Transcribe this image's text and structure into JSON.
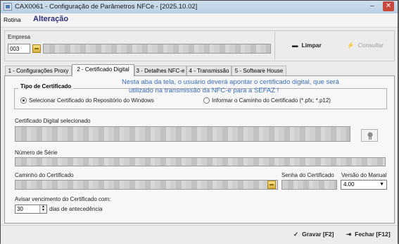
{
  "window": {
    "title": "CAX0061 - Configuração de Parâmetros NFCe - [2025.10.02]",
    "minimize": "–",
    "maximize": "□",
    "close": "✕"
  },
  "menu": {
    "rotina": "Rotina",
    "mode": "Alteração"
  },
  "empresa": {
    "label": "Empresa",
    "code": "003"
  },
  "actions": {
    "limpar": "Limpar",
    "consultar": "Consultar",
    "gravar": "Gravar [F2]",
    "fechar": "Fechar [F12]"
  },
  "tabs": [
    {
      "label": "1 - Configurações Proxy"
    },
    {
      "label": "2 - Certificado Digital"
    },
    {
      "label": "3 - Detalhes NFC-e"
    },
    {
      "label": "4 - Transmissão"
    },
    {
      "label": "5 - Software House"
    }
  ],
  "annotation": {
    "line1": "Nesta aba da tela, o usuário deverá apontar o certificado digital, que será",
    "line2": "utilizado na transmissão da NFC-e para a SEFAZ !"
  },
  "tipo_certificado": {
    "title": "Tipo de Certificado",
    "option_repo": "Selecionar Certificado do Repositório do Windows",
    "option_path": "Informar o Caminho do Certificado (*.pfx; *.p12)"
  },
  "fields": {
    "certificado_label": "Certificado Digital selecionado",
    "serie_label": "Número de Série",
    "caminho_label": "Caminho do Certificado",
    "senha_label": "Senha do Certificado",
    "versao_label": "Versão do Manual",
    "versao_value": "4.00",
    "aviso_label": "Avisar vencimento do Certificado com:",
    "dias_value": "30",
    "dias_suffix": "dias de antecedência"
  },
  "icons": {
    "lookup": "folder-lookup-icon",
    "limpar": "eraser-icon",
    "consultar": "lightning-icon",
    "gravar": "save-icon",
    "fechar": "exit-door-icon",
    "cert": "certificate-icon"
  }
}
